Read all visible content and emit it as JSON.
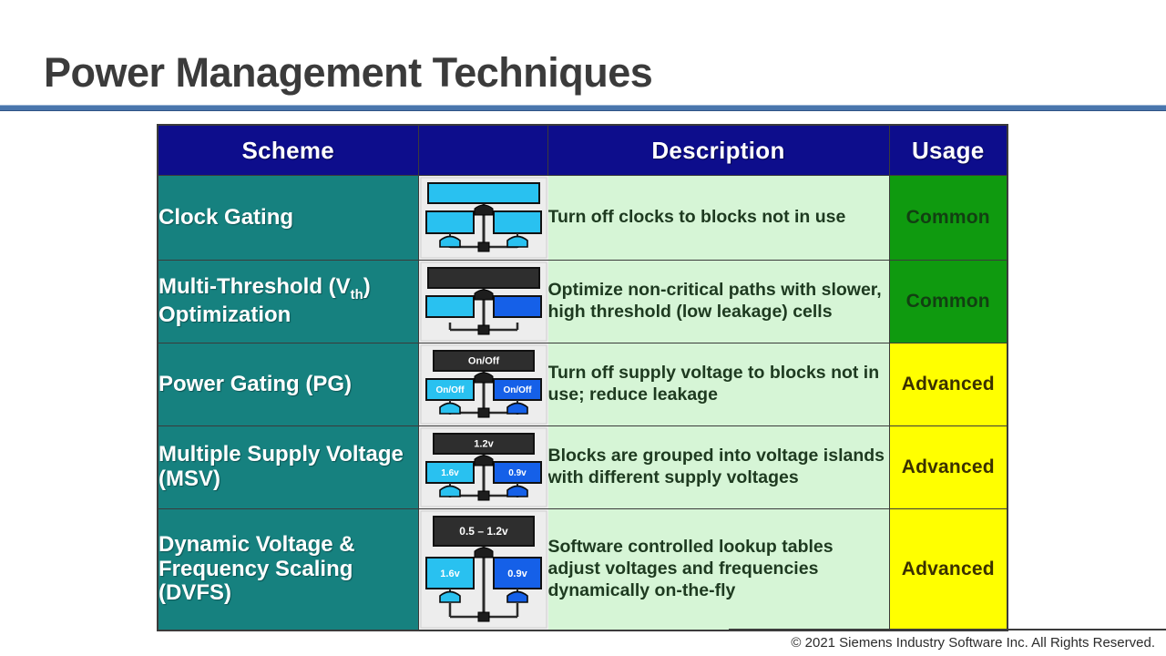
{
  "slide": {
    "title": "Power Management Techniques",
    "footer": "© 2021 Siemens Industry Software Inc. All Rights Reserved."
  },
  "colors": {
    "title_text": "#3b3b3b",
    "rule_blue": "#4a76ad",
    "header_navy": "#0d0d8c",
    "scheme_teal": "#16817f",
    "desc_green": "#d6f5d6",
    "usage_common_green": "#0f9a0f",
    "usage_advanced_yellow": "#ffff00",
    "diagram_bg": "#ededed",
    "block_cyan": "#29c1f0",
    "block_blue": "#1560e8",
    "block_dark": "#2e2e2e"
  },
  "table": {
    "headers": [
      "Scheme",
      "",
      "Description",
      "Usage"
    ],
    "rows": [
      {
        "scheme": "Clock Gating",
        "description": "Turn off clocks to blocks not in use",
        "usage": "Common",
        "usage_level": "common",
        "diagram": {
          "type": "clock-tree",
          "top_label": "",
          "left_label": "",
          "right_label": "",
          "top_color": "#29c1f0",
          "left_color": "#29c1f0",
          "right_color": "#29c1f0",
          "has_buffers": true,
          "top_full_width": true
        }
      },
      {
        "scheme": "Multi-Threshold (V<sub>th</sub>) Optimization",
        "description": "Optimize non-critical paths with slower, high threshold (low leakage) cells",
        "usage": "Common",
        "usage_level": "common",
        "diagram": {
          "type": "block-tree",
          "top_label": "",
          "left_label": "",
          "right_label": "",
          "top_color": "#2e2e2e",
          "left_color": "#29c1f0",
          "right_color": "#1560e8",
          "has_buffers": false,
          "top_full_width": true
        }
      },
      {
        "scheme": "Power Gating (PG)",
        "description": "Turn off supply voltage to blocks not in use; reduce leakage",
        "usage": "Advanced",
        "usage_level": "advanced",
        "diagram": {
          "type": "block-tree",
          "top_label": "On/Off",
          "left_label": "On/Off",
          "right_label": "On/Off",
          "top_color": "#2e2e2e",
          "left_color": "#29c1f0",
          "right_color": "#1560e8",
          "has_buffers": true,
          "top_full_width": false
        }
      },
      {
        "scheme": "Multiple Supply Voltage (MSV)",
        "description": "Blocks are grouped into voltage islands with different supply voltages",
        "usage": "Advanced",
        "usage_level": "advanced",
        "diagram": {
          "type": "block-tree",
          "top_label": "1.2v",
          "left_label": "1.6v",
          "right_label": "0.9v",
          "top_color": "#2e2e2e",
          "left_color": "#29c1f0",
          "right_color": "#1560e8",
          "has_buffers": true,
          "top_full_width": false
        }
      },
      {
        "scheme": "Dynamic Voltage &<br>Frequency Scaling (DVFS)",
        "description": "Software controlled lookup tables adjust voltages and frequencies dynamically on-the-fly",
        "usage": "Advanced",
        "usage_level": "advanced",
        "diagram": {
          "type": "block-tree",
          "top_label": "0.5 – 1.2v",
          "left_label": "1.6v",
          "right_label": "0.9v",
          "top_color": "#2e2e2e",
          "left_color": "#29c1f0",
          "right_color": "#1560e8",
          "has_buffers": true,
          "top_full_width": false
        }
      }
    ]
  }
}
